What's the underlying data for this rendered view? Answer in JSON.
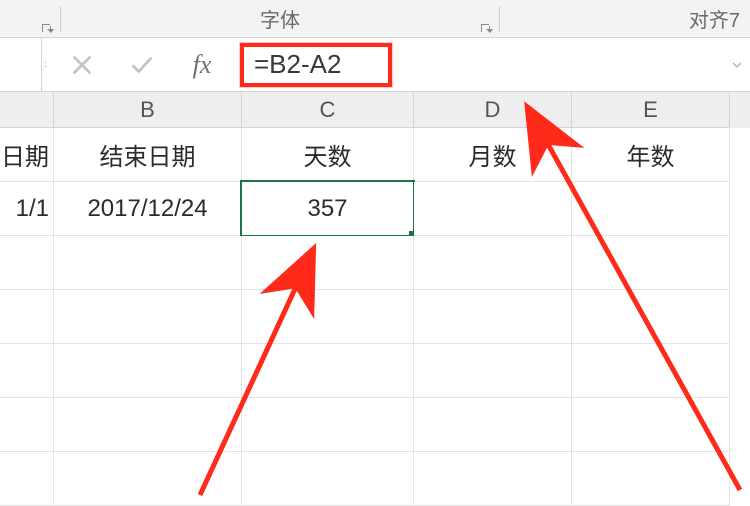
{
  "ribbon": {
    "group_font_label": "字体",
    "group_align_label": "对齐7"
  },
  "formula_bar": {
    "fx_label": "fx",
    "formula": "=B2-A2"
  },
  "columns": {
    "A": {
      "label": "",
      "partial_header": "日期",
      "partial_value": "1/1"
    },
    "B": {
      "label": "B",
      "header": "结束日期",
      "value": "2017/12/24"
    },
    "C": {
      "label": "C",
      "header": "天数",
      "value": "357"
    },
    "D": {
      "label": "D",
      "header": "月数",
      "value": ""
    },
    "E": {
      "label": "E",
      "header": "年数",
      "value": ""
    }
  },
  "colors": {
    "annotation_red": "#ff2a1a",
    "selection_green": "#1f7246"
  }
}
